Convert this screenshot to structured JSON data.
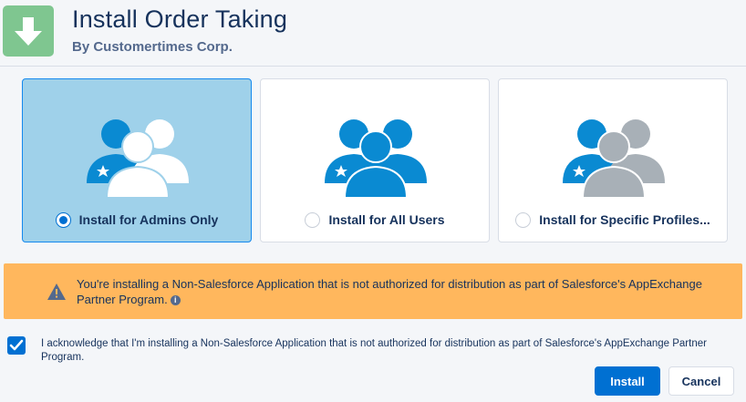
{
  "header": {
    "title": "Install Order Taking",
    "publisher": "By Customertimes Corp.",
    "icon": "download-arrow-icon",
    "icon_color": "#7fc690"
  },
  "options": [
    {
      "label": "Install for Admins Only",
      "selected": true,
      "icon": "admin-users-icon"
    },
    {
      "label": "Install for All Users",
      "selected": false,
      "icon": "all-users-icon"
    },
    {
      "label": "Install for Specific Profiles...",
      "selected": false,
      "icon": "specific-profiles-icon"
    }
  ],
  "warning": {
    "text": "You're installing a Non-Salesforce Application that is not authorized for distribution as part of Salesforce's AppExchange Partner Program.",
    "icon": "warning-icon",
    "info_icon": "info-icon",
    "color": "#ffb75d"
  },
  "acknowledge": {
    "checked": true,
    "text": "I acknowledge that I'm installing a Non-Salesforce Application that is not authorized for distribution as part of Salesforce's AppExchange Partner Program."
  },
  "buttons": {
    "install": "Install",
    "cancel": "Cancel"
  },
  "colors": {
    "brand_blue": "#0070d2",
    "selected_bg": "#9fd1ea",
    "user_blue": "#0a8ad2",
    "user_gray": "#a8b0b7"
  }
}
